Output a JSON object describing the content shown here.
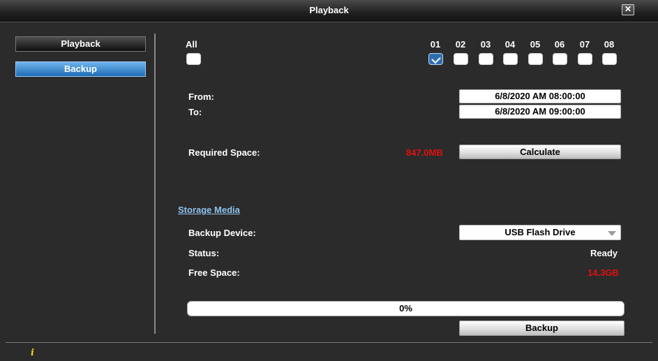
{
  "window": {
    "title": "Playback",
    "close_glyph": "✕"
  },
  "sidebar": {
    "items": [
      {
        "label": "Playback"
      },
      {
        "label": "Backup"
      }
    ]
  },
  "channels": {
    "all_label": "All",
    "all_checked": false,
    "list": [
      {
        "label": "01",
        "checked": true
      },
      {
        "label": "02",
        "checked": false
      },
      {
        "label": "03",
        "checked": false
      },
      {
        "label": "04",
        "checked": false
      },
      {
        "label": "05",
        "checked": false
      },
      {
        "label": "06",
        "checked": false
      },
      {
        "label": "07",
        "checked": false
      },
      {
        "label": "08",
        "checked": false
      }
    ]
  },
  "time": {
    "from_label": "From:",
    "from_value": "6/8/2020 AM 08:00:00",
    "to_label": "To:",
    "to_value": "6/8/2020 AM 09:00:00"
  },
  "space": {
    "required_label": "Required Space:",
    "required_value": "847.0MB",
    "calculate_label": "Calculate"
  },
  "storage": {
    "section_label": "Storage Media",
    "device_label": "Backup Device:",
    "device_value": "USB Flash Drive",
    "status_label": "Status:",
    "status_value": "Ready",
    "free_label": "Free Space:",
    "free_value": "14.3GB"
  },
  "progress": {
    "text": "0%",
    "fraction": 0
  },
  "backup_button_label": "Backup",
  "footer": {
    "info_icon": "i"
  },
  "colors": {
    "accent_blue": "#2f6fb0",
    "warning_red": "#e01010",
    "info_yellow": "#f1d21c"
  }
}
